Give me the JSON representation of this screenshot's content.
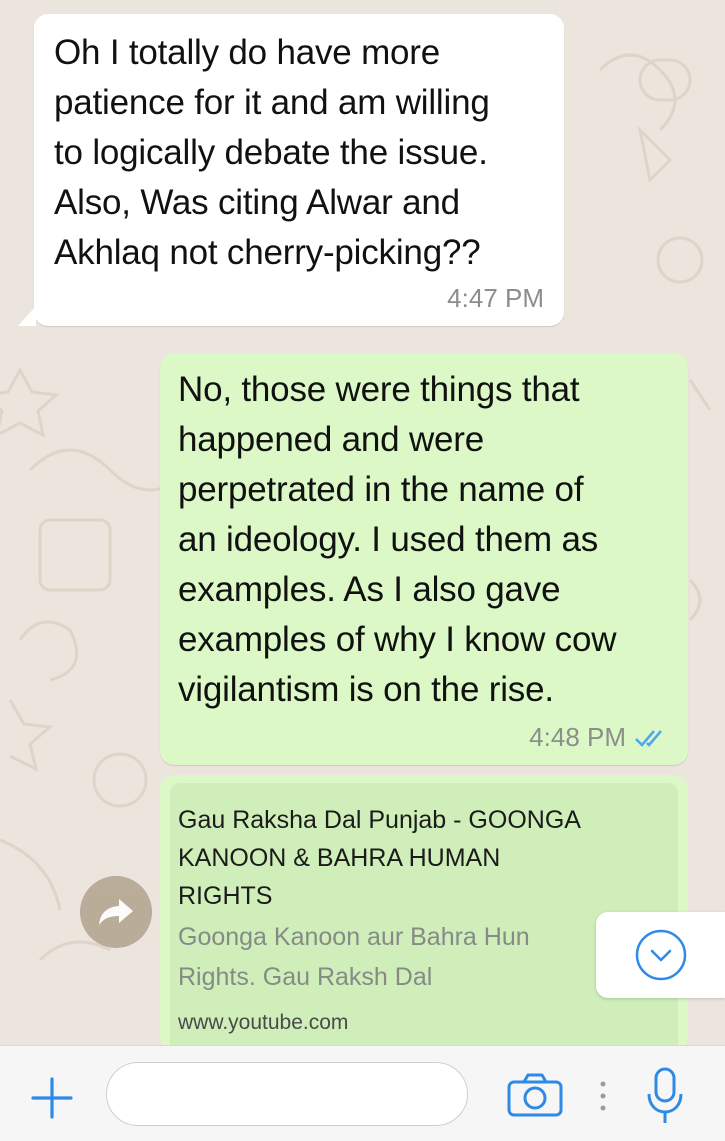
{
  "messages": {
    "incoming": {
      "lines": [
        "Oh I totally do have more",
        "patience for it and am willing",
        "to logically debate the issue.",
        "Also, Was citing Alwar and",
        "Akhlaq not cherry-picking??"
      ],
      "time": "4:47 PM"
    },
    "outgoing": {
      "lines": [
        "No, those were things that",
        "happened and were",
        "perpetrated in the name of",
        "an ideology. I used them as",
        "examples. As I also gave",
        "examples of why I know cow",
        "vigilantism is on the rise."
      ],
      "time": "4:48 PM",
      "status_icon": "double-check-icon"
    },
    "link_preview": {
      "title_lines": [
        "Gau Raksha Dal Punjab - GOONGA",
        "KANOON & BAHRA HUMAN",
        "RIGHTS"
      ],
      "description_lines": [
        "Goonga Kanoon aur Bahra Hun",
        "Rights. Gau Raksh Dal"
      ],
      "domain": "www.youtube.com"
    }
  },
  "controls": {
    "forward_icon": "forward-arrow-icon",
    "scroll_down_icon": "chevron-down-icon",
    "attach_icon": "plus-icon",
    "camera_icon": "camera-icon",
    "mic_icon": "microphone-icon"
  },
  "colors": {
    "accent": "#2f8ae5",
    "incoming_bubble": "#ffffff",
    "outgoing_bubble": "#dcf8c6",
    "link_card": "#cfeeb9",
    "wallpaper": "#ece5dd",
    "read_ticks": "#4fa6ef"
  }
}
